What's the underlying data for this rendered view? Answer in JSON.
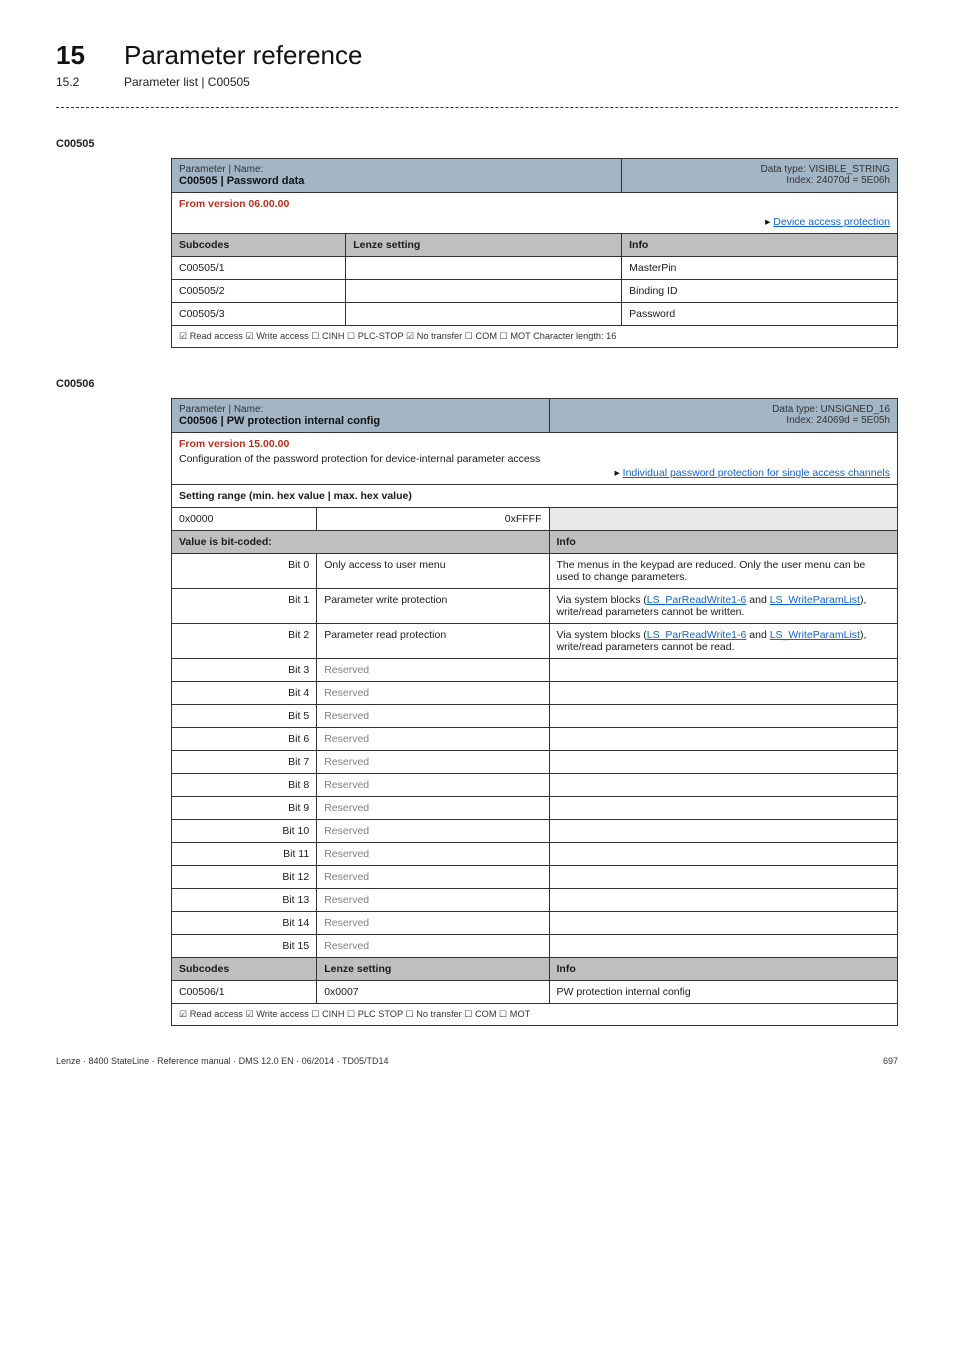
{
  "header": {
    "chapter_num": "15",
    "chapter_title": "Parameter reference",
    "section_num": "15.2",
    "section_title": "Parameter list | C00505"
  },
  "c00505": {
    "heading": "C00505",
    "param_label": "Parameter | Name:",
    "param_code": "C00505 | Password data",
    "dtype_line1": "Data type: VISIBLE_STRING",
    "dtype_line2": "Index: 24070d = 5E06h",
    "from_version": "From version 06.00.00",
    "access_link": "Device access protection",
    "cols": {
      "subcodes": "Subcodes",
      "lenze": "Lenze setting",
      "info": "Info"
    },
    "rows": [
      {
        "sub": "C00505/1",
        "lenze": "",
        "info": "MasterPin"
      },
      {
        "sub": "C00505/2",
        "lenze": "",
        "info": "Binding ID"
      },
      {
        "sub": "C00505/3",
        "lenze": "",
        "info": "Password"
      }
    ],
    "access_flags": "☑ Read access  ☑ Write access  ☐ CINH  ☐ PLC-STOP  ☑ No transfer  ☐ COM  ☐ MOT    Character length: 16"
  },
  "c00506": {
    "heading": "C00506",
    "param_label": "Parameter | Name:",
    "param_code": "C00506 | PW protection internal config",
    "dtype_line1": "Data type: UNSIGNED_16",
    "dtype_line2": "Index: 24069d = 5E05h",
    "from_version": "From version 15.00.00",
    "config_text": "Configuration of the password protection for device-internal parameter access",
    "access_link": "Individual password protection for single access channels",
    "setting_range": "Setting range (min. hex value | max. hex value)",
    "range_min": "0x0000",
    "range_max": "0xFFFF",
    "value_bitcoded": "Value is bit-coded:",
    "info_hdr": "Info",
    "bits": [
      {
        "n": "Bit 0",
        "label": "Only access to user menu",
        "info_plain_a": "The menus in the keypad are reduced. Only the user menu can be used to change parameters."
      },
      {
        "n": "Bit 1",
        "label": "Parameter write protection",
        "info_linked": {
          "a": "Via system blocks (",
          "l1": "LS_ParReadWrite1-6",
          "b": " and ",
          "l2": "LS_WriteParamList",
          "c": "), write/read parameters cannot be written."
        }
      },
      {
        "n": "Bit 2",
        "label": "Parameter read protection",
        "info_linked": {
          "a": "Via system blocks (",
          "l1": "LS_ParReadWrite1-6",
          "b": " and ",
          "l2": "LS_WriteParamList",
          "c": "), write/read parameters cannot be read."
        }
      },
      {
        "n": "Bit 3",
        "label": "Reserved"
      },
      {
        "n": "Bit 4",
        "label": "Reserved"
      },
      {
        "n": "Bit 5",
        "label": "Reserved"
      },
      {
        "n": "Bit 6",
        "label": "Reserved"
      },
      {
        "n": "Bit 7",
        "label": "Reserved"
      },
      {
        "n": "Bit 8",
        "label": "Reserved"
      },
      {
        "n": "Bit 9",
        "label": "Reserved"
      },
      {
        "n": "Bit 10",
        "label": "Reserved"
      },
      {
        "n": "Bit 11",
        "label": "Reserved"
      },
      {
        "n": "Bit 12",
        "label": "Reserved"
      },
      {
        "n": "Bit 13",
        "label": "Reserved"
      },
      {
        "n": "Bit 14",
        "label": "Reserved"
      },
      {
        "n": "Bit 15",
        "label": "Reserved"
      }
    ],
    "subcodes_hdr": "Subcodes",
    "lenze_hdr": "Lenze setting",
    "info_hdr2": "Info",
    "subrow": {
      "sub": "C00506/1",
      "lenze": "0x0007",
      "info": "PW protection internal config"
    },
    "access_flags": "☑ Read access  ☑ Write access  ☐ CINH  ☐ PLC STOP  ☐ No transfer  ☐ COM  ☐ MOT"
  },
  "footer": {
    "left": "Lenze · 8400 StateLine · Reference manual · DMS 12.0 EN · 06/2014 · TD05/TD14",
    "right": "697"
  }
}
